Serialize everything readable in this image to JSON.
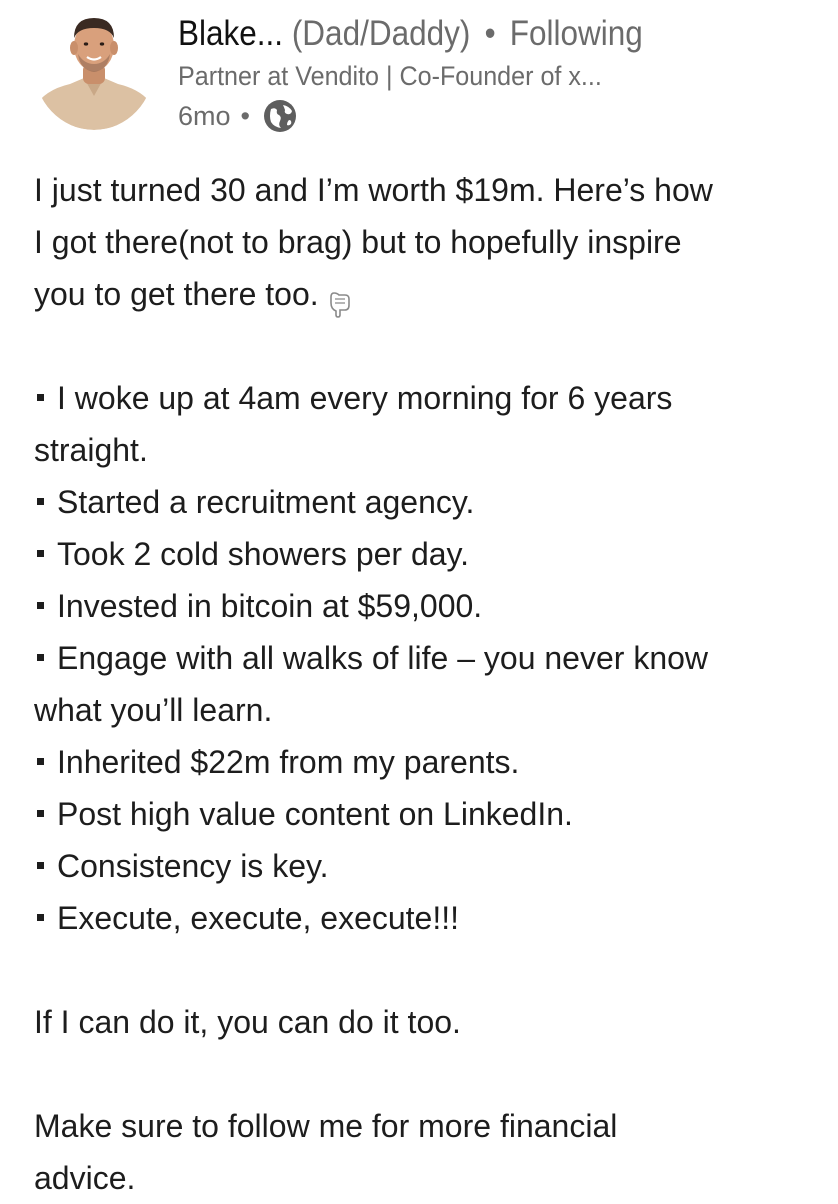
{
  "author": {
    "name": "Blake...",
    "pronouns": "(Dad/Daddy)",
    "separator": "•",
    "follow_status": "Following",
    "headline": "Partner at Vendito | Co-Founder of x...",
    "time_ago": "6mo",
    "time_separator": "•",
    "visibility_icon": "globe-icon"
  },
  "post": {
    "intro_lines": [
      "I just turned 30 and I’m worth $19m. Here’s how",
      "I got there(not to brag) but to hopefully inspire",
      "you to get there too."
    ],
    "intro_emoji_icon": "pointing-down-finger-icon",
    "bullets": [
      [
        "I woke up at 4am every morning for 6 years",
        "straight."
      ],
      [
        "Started a recruitment agency."
      ],
      [
        "Took 2 cold showers per day."
      ],
      [
        "Invested in bitcoin at $59,000."
      ],
      [
        "Engage with all walks of life – you never know",
        "what you’ll learn."
      ],
      [
        "Inherited $22m from my parents."
      ],
      [
        "Post high value content on LinkedIn."
      ],
      [
        "Consistency is key."
      ],
      [
        "Execute, execute, execute!!!"
      ]
    ],
    "closing": "If I can do it, you can do it too.",
    "cta_lines": [
      "Make sure to follow me for more financial",
      "advice."
    ]
  }
}
